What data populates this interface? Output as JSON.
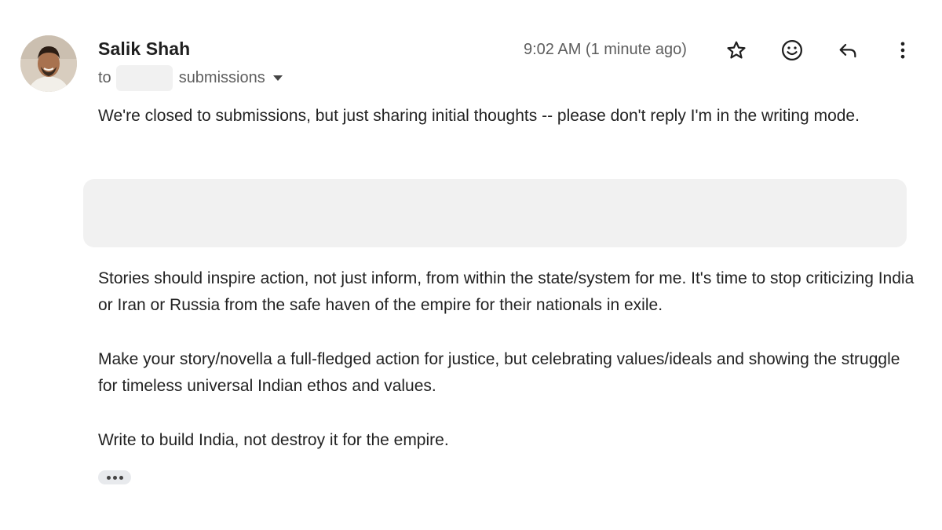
{
  "sender": {
    "name": "Salik Shah"
  },
  "recipients": {
    "to_label": "to",
    "name": "submissions"
  },
  "timestamp": "9:02 AM (1 minute ago)",
  "actions": {
    "star_icon": "star-icon",
    "emoji_icon": "emoji-reaction-icon",
    "reply_icon": "reply-icon",
    "more_icon": "more-vertical-icon"
  },
  "body": {
    "paragraph1": "We're closed to submissions, but just sharing initial thoughts -- please don't reply I'm in the writing mode.",
    "paragraph2": "Stories should inspire action, not just inform, from within the state/system for me. It's time to stop criticizing India or Iran or Russia from the safe haven of the empire for their nationals in exile.",
    "paragraph3": "Make your story/novella a full-fledged action for justice, but celebrating values/ideals and showing the struggle for timeless universal Indian ethos and values.",
    "paragraph4": "Write to build India, not destroy it for the empire."
  },
  "colors": {
    "text": "#222222",
    "secondary_text": "#5e5e5e",
    "redaction": "#f1f1f1"
  }
}
